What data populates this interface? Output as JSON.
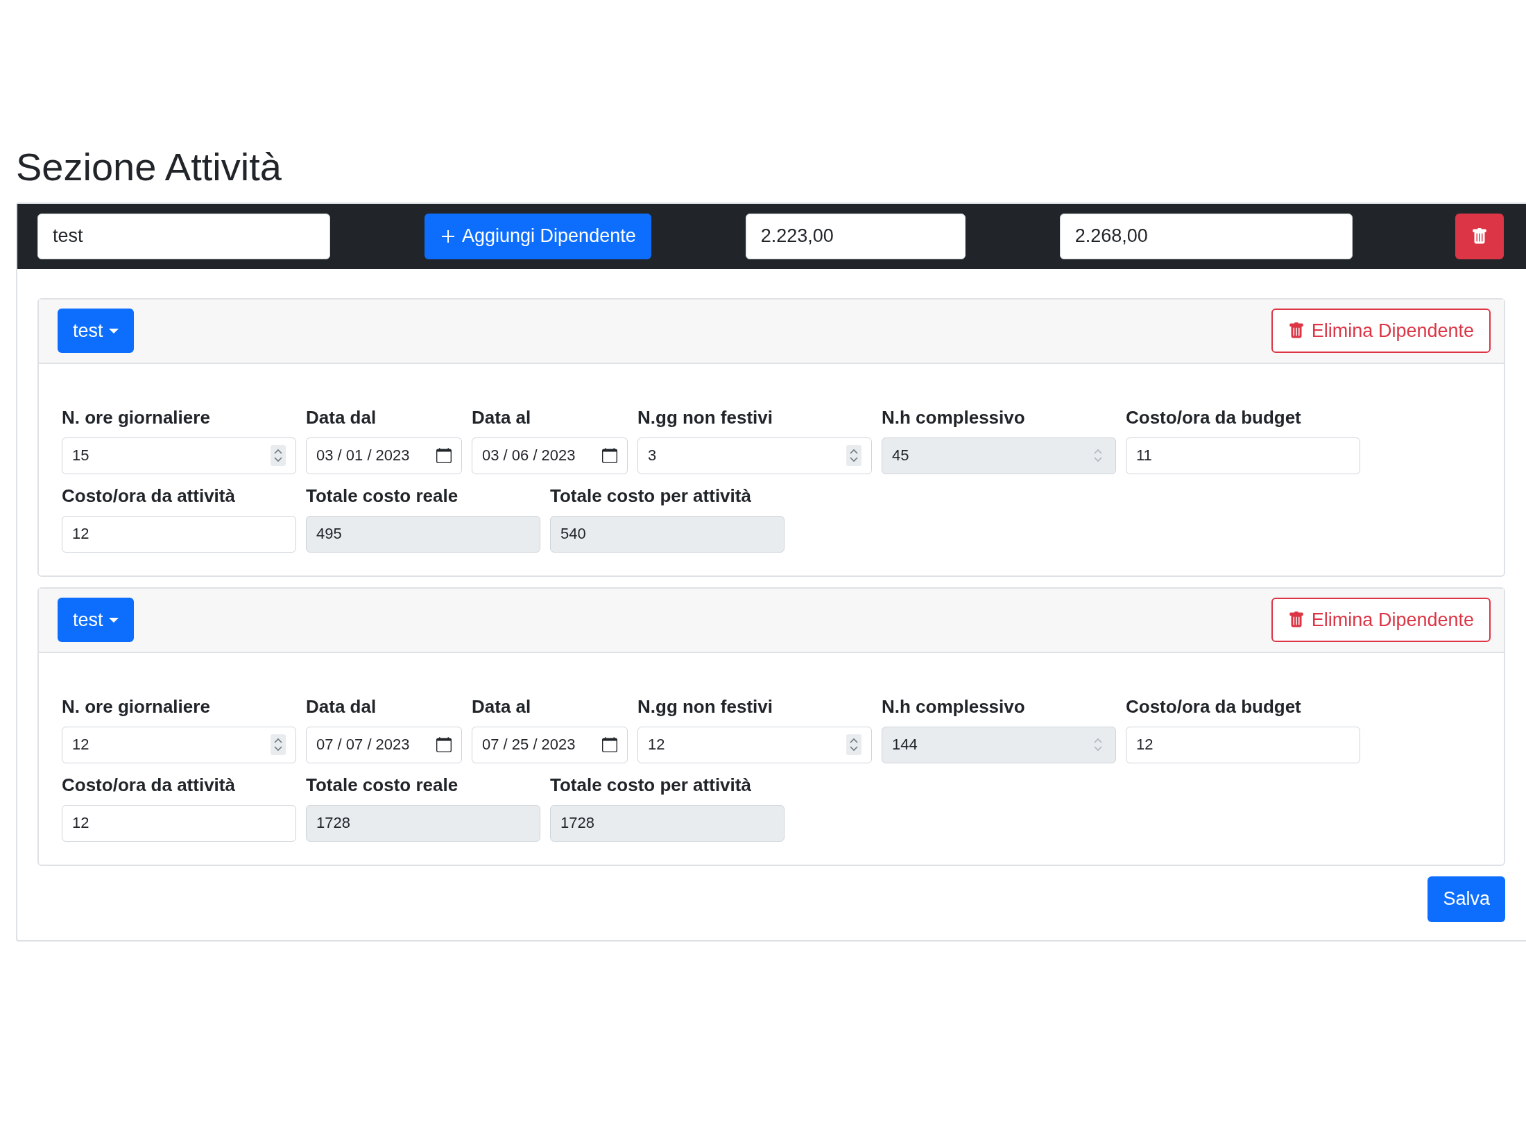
{
  "title": "Sezione Attività",
  "activity_bar": {
    "name_value": "test",
    "add_button": "Aggiungi Dipendente",
    "total_1": "2.223,00",
    "total_2": "2.268,00"
  },
  "employees": [
    {
      "dropdown": "test",
      "delete_button": "Elimina Dipendente",
      "fields": [
        {
          "label": "N. ore giornaliere",
          "value": "15",
          "kind": "number",
          "disabled": false
        },
        {
          "label": "Data dal",
          "value": "03 / 01 / 2023",
          "kind": "date",
          "disabled": false
        },
        {
          "label": "Data al",
          "value": "03 / 06 / 2023",
          "kind": "date",
          "disabled": false
        },
        {
          "label": "N.gg non festivi",
          "value": "3",
          "kind": "number",
          "disabled": false
        },
        {
          "label": "N.h complessivo",
          "value": "45",
          "kind": "number",
          "disabled": true
        },
        {
          "label": "Costo/ora da budget",
          "value": "11",
          "kind": "text",
          "disabled": false
        },
        {
          "label": "Costo/ora da attività",
          "value": "12",
          "kind": "text",
          "disabled": false
        },
        {
          "label": "Totale costo reale",
          "value": "495",
          "kind": "text",
          "disabled": true
        },
        {
          "label": "Totale costo per attività",
          "value": "540",
          "kind": "text",
          "disabled": true
        }
      ]
    },
    {
      "dropdown": "test",
      "delete_button": "Elimina Dipendente",
      "fields": [
        {
          "label": "N. ore giornaliere",
          "value": "12",
          "kind": "number",
          "disabled": false
        },
        {
          "label": "Data dal",
          "value": "07 / 07 / 2023",
          "kind": "date",
          "disabled": false
        },
        {
          "label": "Data al",
          "value": "07 / 25 / 2023",
          "kind": "date",
          "disabled": false
        },
        {
          "label": "N.gg non festivi",
          "value": "12",
          "kind": "number",
          "disabled": false
        },
        {
          "label": "N.h complessivo",
          "value": "144",
          "kind": "number",
          "disabled": true
        },
        {
          "label": "Costo/ora da budget",
          "value": "12",
          "kind": "text",
          "disabled": false
        },
        {
          "label": "Costo/ora da attività",
          "value": "12",
          "kind": "text",
          "disabled": false
        },
        {
          "label": "Totale costo reale",
          "value": "1728",
          "kind": "text",
          "disabled": true
        },
        {
          "label": "Totale costo per attività",
          "value": "1728",
          "kind": "text",
          "disabled": true
        }
      ]
    }
  ],
  "save_button": "Salva"
}
